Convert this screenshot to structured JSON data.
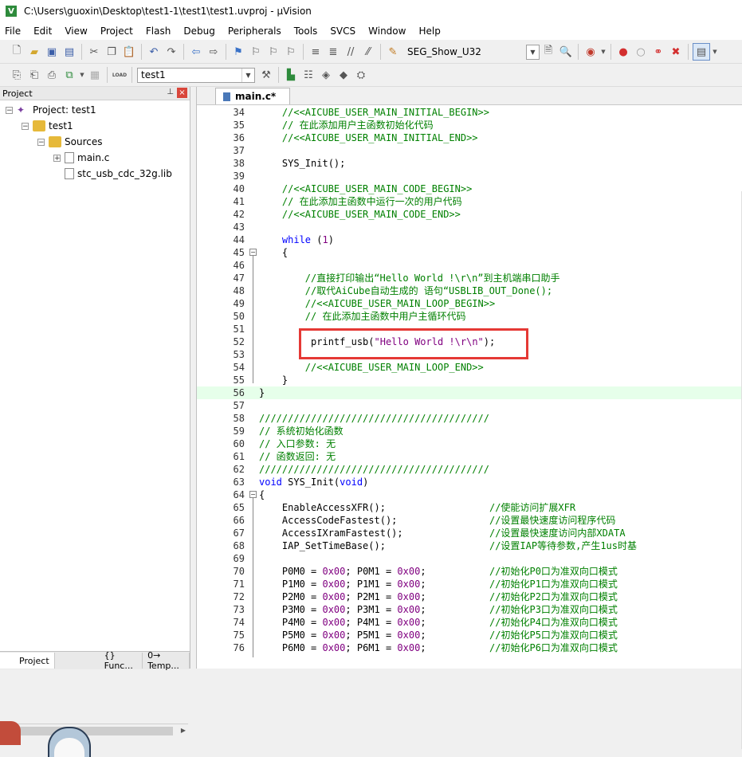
{
  "window": {
    "title": "C:\\Users\\guoxin\\Desktop\\test1-1\\test1\\test1.uvproj - µVision",
    "app_icon": "V"
  },
  "menu": [
    "File",
    "Edit",
    "View",
    "Project",
    "Flash",
    "Debug",
    "Peripherals",
    "Tools",
    "SVCS",
    "Window",
    "Help"
  ],
  "toolbar": {
    "target_combo": "SEG_Show_U32",
    "project_combo": "test1",
    "load_label": "LOAD"
  },
  "project_panel": {
    "title": "Project",
    "tree": [
      {
        "label": "Project: test1",
        "level": 0,
        "expander": "−"
      },
      {
        "label": "test1",
        "level": 1,
        "expander": "−"
      },
      {
        "label": "Sources",
        "level": 2,
        "expander": "−"
      },
      {
        "label": "main.c",
        "level": 3,
        "expander": "+"
      },
      {
        "label": "stc_usb_cdc_32g.lib",
        "level": 3,
        "expander": ""
      }
    ],
    "bottom_tabs": [
      "Project",
      "{} Func...",
      "0→ Temp..."
    ]
  },
  "editor": {
    "tab_label": "main.c*",
    "lines": [
      {
        "n": "34",
        "segments": [
          {
            "t": "    //<<AICUBE_USER_MAIN_INITIAL_BEGIN>>",
            "c": "comment"
          }
        ]
      },
      {
        "n": "35",
        "segments": [
          {
            "t": "    // 在此添加用户主函数初始化代码",
            "c": "comment"
          }
        ]
      },
      {
        "n": "36",
        "segments": [
          {
            "t": "    //<<AICUBE_USER_MAIN_INITIAL_END>>",
            "c": "comment"
          }
        ]
      },
      {
        "n": "37",
        "segments": []
      },
      {
        "n": "38",
        "segments": [
          {
            "t": "    SYS_Init();",
            "c": "plain"
          }
        ]
      },
      {
        "n": "39",
        "segments": []
      },
      {
        "n": "40",
        "segments": [
          {
            "t": "    //<<AICUBE_USER_MAIN_CODE_BEGIN>>",
            "c": "comment"
          }
        ]
      },
      {
        "n": "41",
        "segments": [
          {
            "t": "    // 在此添加主函数中运行一次的用户代码",
            "c": "comment"
          }
        ]
      },
      {
        "n": "42",
        "segments": [
          {
            "t": "    //<<AICUBE_USER_MAIN_CODE_END>>",
            "c": "comment"
          }
        ]
      },
      {
        "n": "43",
        "segments": []
      },
      {
        "n": "44",
        "segments": [
          {
            "t": "    ",
            "c": "plain"
          },
          {
            "t": "while",
            "c": "keyword"
          },
          {
            "t": " (",
            "c": "plain"
          },
          {
            "t": "1",
            "c": "number"
          },
          {
            "t": ")",
            "c": "plain"
          }
        ]
      },
      {
        "n": "45",
        "segments": [
          {
            "t": "    {",
            "c": "plain"
          }
        ]
      },
      {
        "n": "46",
        "segments": []
      },
      {
        "n": "47",
        "segments": [
          {
            "t": "        //直接打印输出“Hello World !\\r\\n”到主机端串口助手",
            "c": "comment"
          }
        ]
      },
      {
        "n": "48",
        "segments": [
          {
            "t": "        //取代AiCube自动生成的 语句“USBLIB_OUT_Done();",
            "c": "comment"
          }
        ]
      },
      {
        "n": "49",
        "segments": [
          {
            "t": "        //<<AICUBE_USER_MAIN_LOOP_BEGIN>>",
            "c": "comment"
          }
        ]
      },
      {
        "n": "50",
        "segments": [
          {
            "t": "        // 在此添加主函数中用户主循环代码",
            "c": "comment"
          }
        ]
      },
      {
        "n": "51",
        "segments": []
      },
      {
        "n": "52",
        "segments": [
          {
            "t": "         printf_usb(",
            "c": "plain"
          },
          {
            "t": "\"Hello World !\\r\\n\"",
            "c": "string"
          },
          {
            "t": ");",
            "c": "plain"
          }
        ]
      },
      {
        "n": "53",
        "segments": []
      },
      {
        "n": "54",
        "segments": [
          {
            "t": "        //<<AICUBE_USER_MAIN_LOOP_END>>",
            "c": "comment"
          }
        ]
      },
      {
        "n": "55",
        "segments": [
          {
            "t": "    }",
            "c": "plain"
          }
        ]
      },
      {
        "n": "56",
        "segments": [
          {
            "t": "}",
            "c": "plain"
          }
        ],
        "highlight": true
      },
      {
        "n": "57",
        "segments": []
      },
      {
        "n": "58",
        "segments": [
          {
            "t": "////////////////////////////////////////",
            "c": "comment"
          }
        ]
      },
      {
        "n": "59",
        "segments": [
          {
            "t": "// 系统初始化函数",
            "c": "comment"
          }
        ]
      },
      {
        "n": "60",
        "segments": [
          {
            "t": "// 入口参数: 无",
            "c": "comment"
          }
        ]
      },
      {
        "n": "61",
        "segments": [
          {
            "t": "// 函数返回: 无",
            "c": "comment"
          }
        ]
      },
      {
        "n": "62",
        "segments": [
          {
            "t": "////////////////////////////////////////",
            "c": "comment"
          }
        ]
      },
      {
        "n": "63",
        "segments": [
          {
            "t": "void",
            "c": "keyword"
          },
          {
            "t": " SYS_Init(",
            "c": "plain"
          },
          {
            "t": "void",
            "c": "keyword"
          },
          {
            "t": ")",
            "c": "plain"
          }
        ]
      },
      {
        "n": "64",
        "segments": [
          {
            "t": "{",
            "c": "plain"
          }
        ]
      },
      {
        "n": "65",
        "segments": [
          {
            "t": "    EnableAccessXFR();                  ",
            "c": "plain"
          },
          {
            "t": "//使能访问扩展XFR",
            "c": "comment"
          }
        ]
      },
      {
        "n": "66",
        "segments": [
          {
            "t": "    AccessCodeFastest();                ",
            "c": "plain"
          },
          {
            "t": "//设置最快速度访问程序代码",
            "c": "comment"
          }
        ]
      },
      {
        "n": "67",
        "segments": [
          {
            "t": "    AccessIXramFastest();               ",
            "c": "plain"
          },
          {
            "t": "//设置最快速度访问内部XDATA",
            "c": "comment"
          }
        ]
      },
      {
        "n": "68",
        "segments": [
          {
            "t": "    IAP_SetTimeBase();                  ",
            "c": "plain"
          },
          {
            "t": "//设置IAP等待参数,产生1us时基",
            "c": "comment"
          }
        ]
      },
      {
        "n": "69",
        "segments": []
      },
      {
        "n": "70",
        "segments": [
          {
            "t": "    P0M0 = ",
            "c": "plain"
          },
          {
            "t": "0x00",
            "c": "number"
          },
          {
            "t": "; P0M1 = ",
            "c": "plain"
          },
          {
            "t": "0x00",
            "c": "number"
          },
          {
            "t": ";           ",
            "c": "plain"
          },
          {
            "t": "//初始化P0口为准双向口模式",
            "c": "comment"
          }
        ]
      },
      {
        "n": "71",
        "segments": [
          {
            "t": "    P1M0 = ",
            "c": "plain"
          },
          {
            "t": "0x00",
            "c": "number"
          },
          {
            "t": "; P1M1 = ",
            "c": "plain"
          },
          {
            "t": "0x00",
            "c": "number"
          },
          {
            "t": ";           ",
            "c": "plain"
          },
          {
            "t": "//初始化P1口为准双向口模式",
            "c": "comment"
          }
        ]
      },
      {
        "n": "72",
        "segments": [
          {
            "t": "    P2M0 = ",
            "c": "plain"
          },
          {
            "t": "0x00",
            "c": "number"
          },
          {
            "t": "; P2M1 = ",
            "c": "plain"
          },
          {
            "t": "0x00",
            "c": "number"
          },
          {
            "t": ";           ",
            "c": "plain"
          },
          {
            "t": "//初始化P2口为准双向口模式",
            "c": "comment"
          }
        ]
      },
      {
        "n": "73",
        "segments": [
          {
            "t": "    P3M0 = ",
            "c": "plain"
          },
          {
            "t": "0x00",
            "c": "number"
          },
          {
            "t": "; P3M1 = ",
            "c": "plain"
          },
          {
            "t": "0x00",
            "c": "number"
          },
          {
            "t": ";           ",
            "c": "plain"
          },
          {
            "t": "//初始化P3口为准双向口模式",
            "c": "comment"
          }
        ]
      },
      {
        "n": "74",
        "segments": [
          {
            "t": "    P4M0 = ",
            "c": "plain"
          },
          {
            "t": "0x00",
            "c": "number"
          },
          {
            "t": "; P4M1 = ",
            "c": "plain"
          },
          {
            "t": "0x00",
            "c": "number"
          },
          {
            "t": ";           ",
            "c": "plain"
          },
          {
            "t": "//初始化P4口为准双向口模式",
            "c": "comment"
          }
        ]
      },
      {
        "n": "75",
        "segments": [
          {
            "t": "    P5M0 = ",
            "c": "plain"
          },
          {
            "t": "0x00",
            "c": "number"
          },
          {
            "t": "; P5M1 = ",
            "c": "plain"
          },
          {
            "t": "0x00",
            "c": "number"
          },
          {
            "t": ";           ",
            "c": "plain"
          },
          {
            "t": "//初始化P5口为准双向口模式",
            "c": "comment"
          }
        ]
      },
      {
        "n": "76",
        "segments": [
          {
            "t": "    P6M0 = ",
            "c": "plain"
          },
          {
            "t": "0x00",
            "c": "number"
          },
          {
            "t": "; P6M1 = ",
            "c": "plain"
          },
          {
            "t": "0x00",
            "c": "number"
          },
          {
            "t": ";           ",
            "c": "plain"
          },
          {
            "t": "//初始化P6口为准双向口模式",
            "c": "comment"
          }
        ]
      }
    ]
  },
  "colors": {
    "comment": "#008000",
    "keyword": "#0000ff",
    "string": "#800080",
    "highlight_line": "#e6ffea",
    "annotation_box": "#e53935"
  },
  "icons": {
    "toolbar1": [
      "new-file-icon",
      "open-folder-icon",
      "save-icon",
      "save-all-icon",
      "cut-icon",
      "copy-icon",
      "paste-icon",
      "undo-icon",
      "redo-icon",
      "nav-back-icon",
      "nav-forward-icon",
      "bookmark-icon",
      "prev-bookmark-icon",
      "next-bookmark-icon",
      "clear-bookmarks-icon",
      "indent-icon",
      "unindent-icon",
      "comment-icon",
      "uncomment-icon",
      "find-in-files-icon",
      "find-icon",
      "debug-start-icon",
      "breakpoint-insert-icon",
      "breakpoint-disable-icon",
      "breakpoint-kill-icon",
      "breakpoint-clear-icon",
      "window-layout-icon"
    ],
    "toolbar2": [
      "translate-icon",
      "build-icon",
      "rebuild-icon",
      "batch-build-icon",
      "stop-build-icon",
      "download-icon",
      "target-options-icon",
      "manage-components-icon",
      "file-extensions-icon",
      "pack-installer-icon",
      "select-packs-icon",
      "manage-run-env-icon"
    ]
  }
}
